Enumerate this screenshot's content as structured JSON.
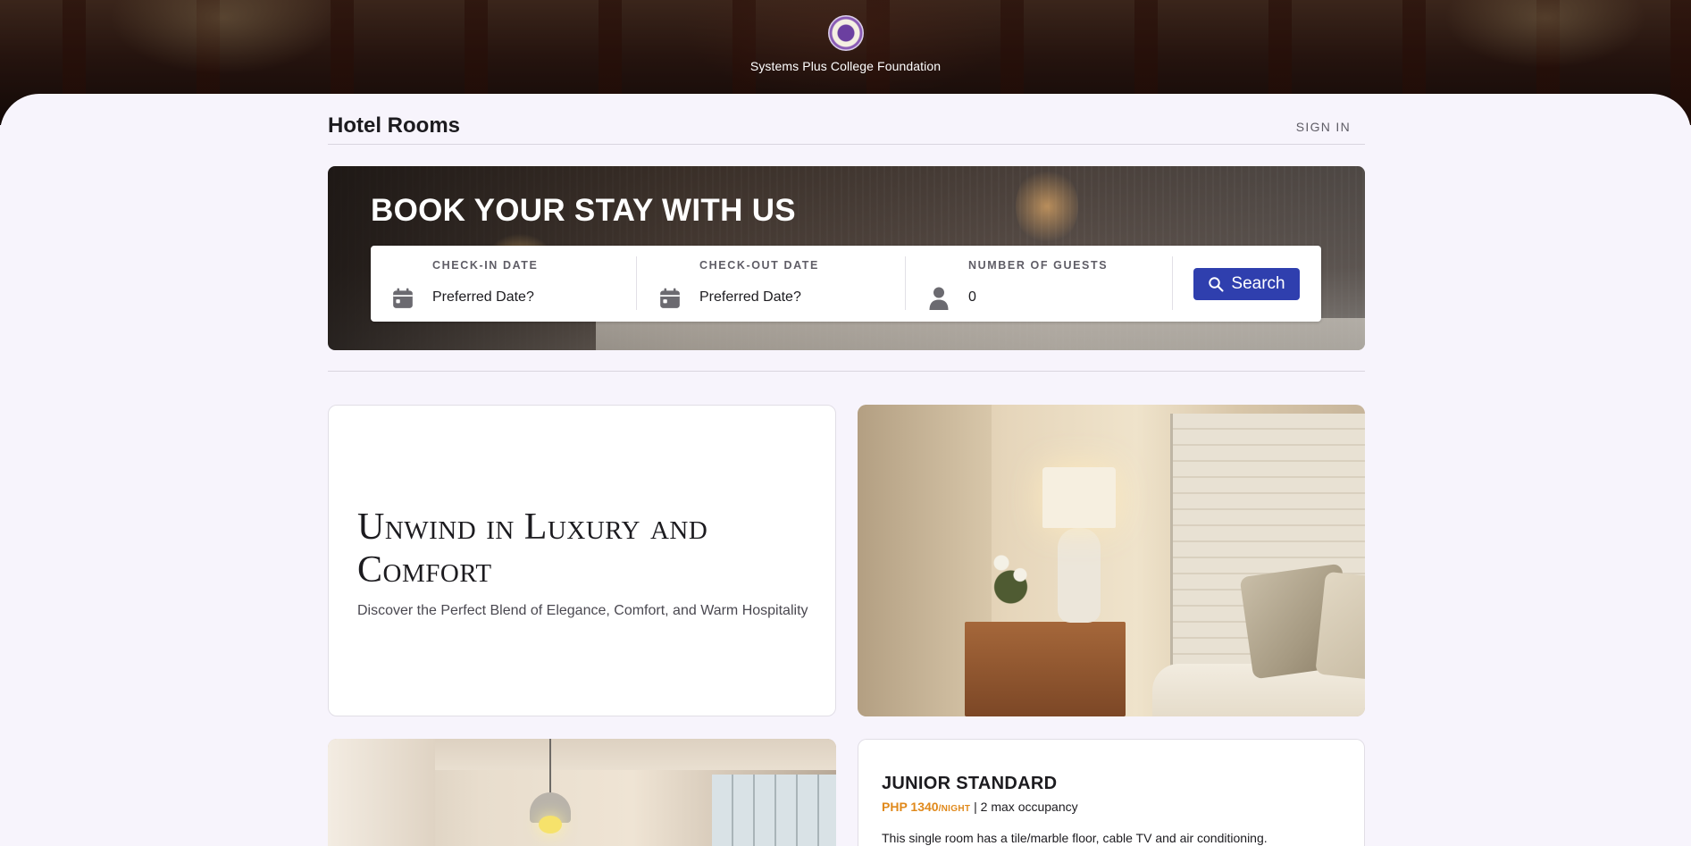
{
  "header": {
    "organization": "Systems Plus College Foundation",
    "logo_icon": "college-seal-logo"
  },
  "topbar": {
    "title": "Hotel Rooms",
    "signin_label": "SIGN IN"
  },
  "booking": {
    "title": "BOOK YOUR STAY WITH US",
    "checkin": {
      "label": "CHECK-IN DATE",
      "value": "Preferred Date?",
      "icon": "calendar-icon"
    },
    "checkout": {
      "label": "CHECK-OUT DATE",
      "value": "Preferred Date?",
      "icon": "calendar-icon"
    },
    "guests": {
      "label": "NUMBER OF GUESTS",
      "value": "0",
      "icon": "person-icon"
    },
    "search_label": "Search",
    "search_color": "#2f3fae"
  },
  "intro": {
    "title": "Unwind in Luxury and Comfort",
    "subtitle": "Discover the Perfect Blend of Elegance, Comfort, and Warm Hospitality"
  },
  "rooms": [
    {
      "name": "JUNIOR STANDARD",
      "price": "PHP 1340",
      "per": "/NIGHT",
      "occupancy": "| 2 max occupancy",
      "description": "This single room has a tile/marble floor, cable TV and air conditioning."
    }
  ],
  "colors": {
    "accent": "#2f3fae",
    "price": "#e0891b",
    "background": "#f7f4fc"
  }
}
